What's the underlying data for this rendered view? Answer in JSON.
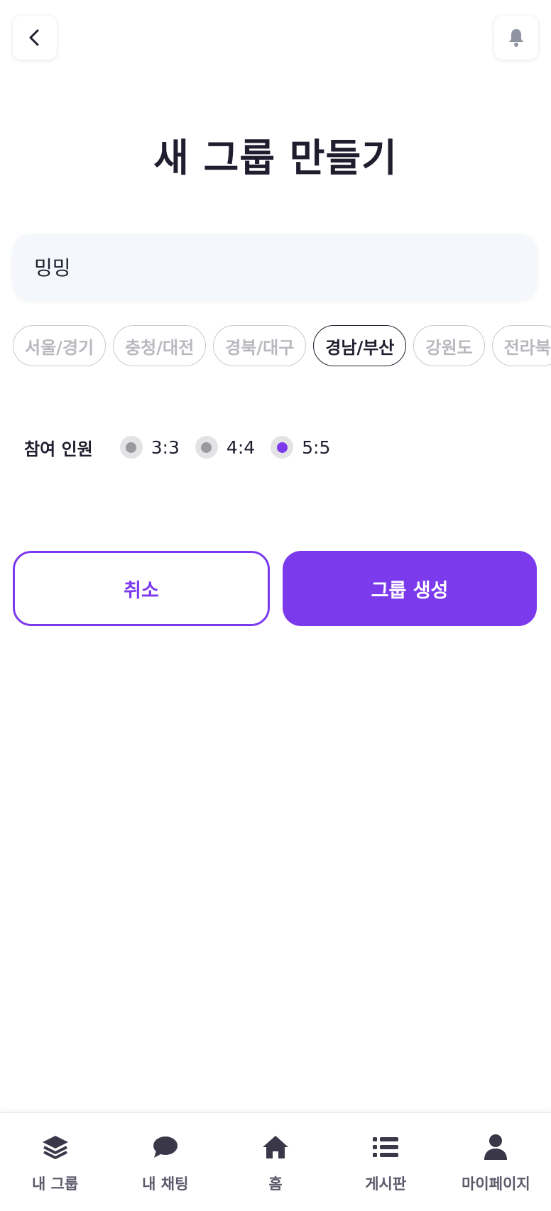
{
  "header": {
    "back_icon": "chevron-left-icon",
    "bell_icon": "bell-icon"
  },
  "page": {
    "title": "새 그룹 만들기"
  },
  "group_name": {
    "value": "밍밍",
    "placeholder": ""
  },
  "regions": [
    {
      "label": "서울/경기",
      "selected": false
    },
    {
      "label": "충청/대전",
      "selected": false
    },
    {
      "label": "경북/대구",
      "selected": false
    },
    {
      "label": "경남/부산",
      "selected": true
    },
    {
      "label": "강원도",
      "selected": false
    },
    {
      "label": "전라북",
      "selected": false
    }
  ],
  "members": {
    "label": "참여 인원",
    "options": [
      {
        "label": "3:3",
        "checked": false
      },
      {
        "label": "4:4",
        "checked": false
      },
      {
        "label": "5:5",
        "checked": true
      }
    ]
  },
  "actions": {
    "cancel_label": "취소",
    "create_label": "그룹 생성"
  },
  "bottom_nav": {
    "items": [
      {
        "label": "내 그룹",
        "icon": "layers-icon"
      },
      {
        "label": "내 채팅",
        "icon": "chat-bubble-icon"
      },
      {
        "label": "홈",
        "icon": "home-icon"
      },
      {
        "label": "게시판",
        "icon": "list-icon"
      },
      {
        "label": "마이페이지",
        "icon": "user-icon"
      }
    ]
  },
  "colors": {
    "accent": "#7c3aed",
    "text": "#1f1d2e",
    "muted": "#b8b8bf"
  }
}
